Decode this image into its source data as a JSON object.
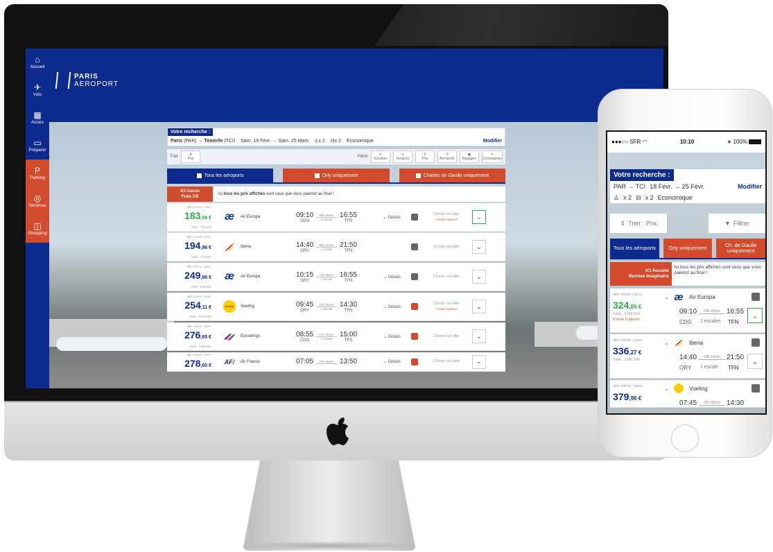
{
  "desktop": {
    "nav": [
      {
        "label": "Accueil",
        "icon": "home-icon"
      },
      {
        "label": "Vols",
        "icon": "plane-icon"
      },
      {
        "label": "Accès",
        "icon": "map-icon"
      },
      {
        "label": "Préparer",
        "icon": "suitcase-icon"
      },
      {
        "label": "Parking",
        "icon": "parking-icon"
      },
      {
        "label": "Services",
        "icon": "services-icon"
      },
      {
        "label": "Shopping",
        "icon": "shopping-icon"
      }
    ],
    "logo": {
      "line1": "PARIS",
      "line2": "AEROPORT"
    },
    "search": {
      "header": "Votre recherche :",
      "route_from": "Paris",
      "route_from_code": "(PAR)",
      "route_to": "Tenerife",
      "route_to_code": "(TCI)",
      "dates": "Sam. 18 Févr. → Sam. 25 Mars",
      "adults": "x 2",
      "seats": "x 2",
      "cabin": "Economique",
      "modify": "Modifier"
    },
    "sort": {
      "label": "Trier",
      "by": "Prix"
    },
    "filter": {
      "label": "Filtrer",
      "options": [
        "Escales",
        "Horaires",
        "Prix",
        "Aéroports",
        "Bagages",
        "Compagnies"
      ]
    },
    "tabs": [
      "Tous les aéroports",
      "Orly uniquement",
      "Charles de Gaulle uniquement"
    ],
    "notice": {
      "tag_line1": "ICI Aucun",
      "tag_line2": "Frais CB",
      "message_pre": "Ici ",
      "message_bold": "tous les prix affichés",
      "message_post": " sont ceux que vous paierez au final !"
    },
    "flights": [
      {
        "label": "aller retour / pers.",
        "price": "183",
        "cents": ",88 €",
        "total": "Total : 734,52€",
        "airline": "Air Europa",
        "dep": "09:10",
        "dep_ap": "CDG",
        "duration": "08h 45min",
        "stops": "2 escale",
        "arr": "16:55",
        "arr_ap": "TFN",
        "details": "⌄ Détails",
        "choose": "Choisir cet aller",
        "remaining": "Il reste 6 places",
        "selected": true
      },
      {
        "label": "aller retour / pers.",
        "price": "194",
        "cents": ",96 €",
        "total": "Total : 779,84€",
        "airline": "Iberia",
        "dep": "14:40",
        "dep_ap": "ORY",
        "duration": "08h 10min",
        "stops": "1 escale",
        "arr": "21:50",
        "arr_ap": "TFN",
        "details": "",
        "choose": "Choisir cet aller",
        "remaining": "",
        "selected": false
      },
      {
        "label": "aller retour / pers.",
        "price": "249",
        "cents": ",96 €",
        "total": "Total : 999,84€",
        "airline": "Air Europa",
        "dep": "10:15",
        "dep_ap": "ORY",
        "duration": "07h 40min",
        "stops": "1 escale",
        "arr": "16:55",
        "arr_ap": "TFN",
        "details": "⌄ Détails",
        "choose": "Choisir cet aller",
        "remaining": "",
        "selected": false
      },
      {
        "label": "aller retour / pers.",
        "price": "254",
        "cents": ",11 €",
        "total": "Total : 1016,44€",
        "airline": "Vueling",
        "dep": "09:45",
        "dep_ap": "ORY",
        "duration": "07h 40min",
        "stops": "1 escale",
        "arr": "14:30",
        "arr_ap": "TFN",
        "details": "⌄ Détails",
        "choose": "Choisir cet aller",
        "remaining": "Il reste 4 places",
        "selected": false
      },
      {
        "label": "aller retour / pers.",
        "price": "276",
        "cents": ",65 €",
        "total": "Total : 1106,60€",
        "airline": "Eurowings",
        "dep": "08:55",
        "dep_ap": "CDG",
        "duration": "07h 45min",
        "stops": "1 escale",
        "arr": "15:00",
        "arr_ap": "TFS",
        "details": "⌄ Détails",
        "choose": "Choisir cet aller",
        "remaining": "",
        "selected": false
      },
      {
        "label": "aller retour / pers.",
        "price": "278",
        "cents": ",60 €",
        "total": "",
        "airline": "Air France",
        "dep": "07:05",
        "dep_ap": "",
        "duration": "07h 45min",
        "stops": "",
        "arr": "13:50",
        "arr_ap": "",
        "details": "⌄ Détails",
        "choose": "Choisir cet aller",
        "remaining": "",
        "selected": false
      }
    ]
  },
  "phone": {
    "carrier": "●●●○○ SFR",
    "time": "10:10",
    "battery": "100%",
    "search": {
      "header": "Votre recherche :",
      "route": "PAR → TCI",
      "dates": "18 Févr. → 25 Févr.",
      "modify": "Modifier",
      "adults": "x 2",
      "seats": "x 2",
      "cabin": "Economique"
    },
    "sort": "Trier : Prix",
    "filter": "Filtrer",
    "tabs": [
      "Tous les aéroports",
      "Orly uniquement",
      "Ch. de Gaulle uniquement"
    ],
    "notice": {
      "tag1": "ICI Aucune",
      "tag2": "Remise imaginaire",
      "msg": "Ici tous les prix affichés sont ceux que vous paierez au final !"
    },
    "flights": [
      {
        "label": "aller retour / pers.",
        "price": "324",
        "cents": ",89 €",
        "total": "Total : 1299,56€",
        "remaining": "Il reste 6 places",
        "airline": "Air Europa",
        "dep": "09:10",
        "duration": "08h 45min",
        "arr": "16:55",
        "dep_ap": "CDG",
        "stops": "2 escales",
        "arr_ap": "TFN"
      },
      {
        "label": "aller retour / pers.",
        "price": "336",
        "cents": ",27 €",
        "total": "Total : 1345,08€",
        "remaining": "",
        "airline": "Iberia",
        "dep": "14:40",
        "duration": "08h 10min",
        "arr": "21:50",
        "dep_ap": "ORY",
        "stops": "1 escale",
        "arr_ap": "TFN"
      },
      {
        "label": "aller retour / pers.",
        "price": "379",
        "cents": ",96 €",
        "total": "",
        "remaining": "",
        "airline": "Vueling",
        "dep": "07:45",
        "duration": "06h 45min",
        "arr": "14:30",
        "dep_ap": "",
        "stops": "",
        "arr_ap": ""
      }
    ]
  },
  "colors": {
    "brand_blue": "#0d2b8c",
    "accent_red": "#d34b2d",
    "price_green": "#2fa84f"
  }
}
